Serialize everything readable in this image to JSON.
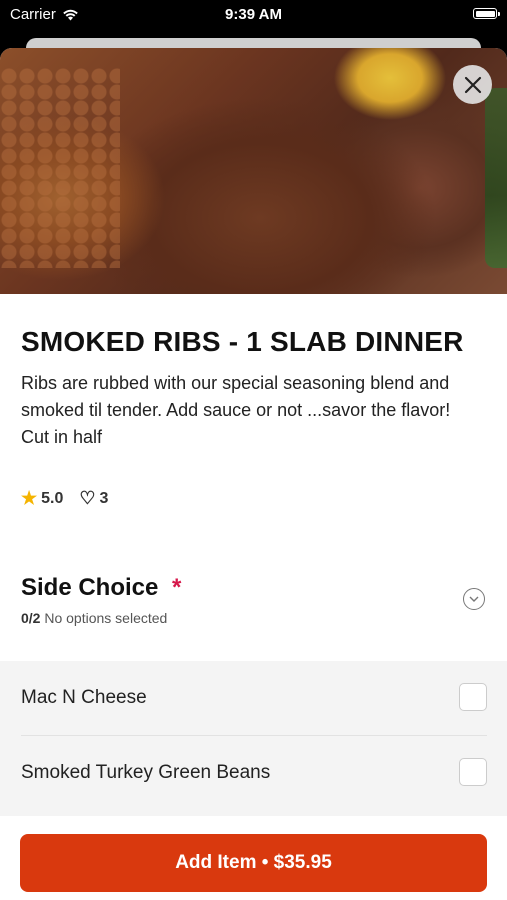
{
  "status_bar": {
    "carrier": "Carrier",
    "time": "9:39 AM"
  },
  "item": {
    "title": "SMOKED RIBS - 1 SLAB DINNER",
    "description_lines": [
      "Ribs are rubbed with our special seasoning blend and smoked til tender.  Add sauce or not ...savor the flavor!",
      "Cut in half"
    ],
    "rating": "5.0",
    "likes": "3"
  },
  "side_choice": {
    "title": "Side Choice",
    "required_mark": "*",
    "count": "0/2",
    "status": "No options selected",
    "options": [
      {
        "label": "Mac N Cheese",
        "checked": false
      },
      {
        "label": "Smoked Turkey Green Beans",
        "checked": false
      }
    ]
  },
  "add_button": {
    "label": "Add Item • $35.95"
  },
  "colors": {
    "accent": "#d9390e",
    "required": "#d6194b",
    "star": "#f5b400"
  },
  "icons": {
    "wifi": "wifi-icon",
    "battery": "battery-icon",
    "close": "close-icon",
    "star": "star-icon",
    "heart": "heart-icon",
    "chevron": "chevron-down-icon"
  }
}
